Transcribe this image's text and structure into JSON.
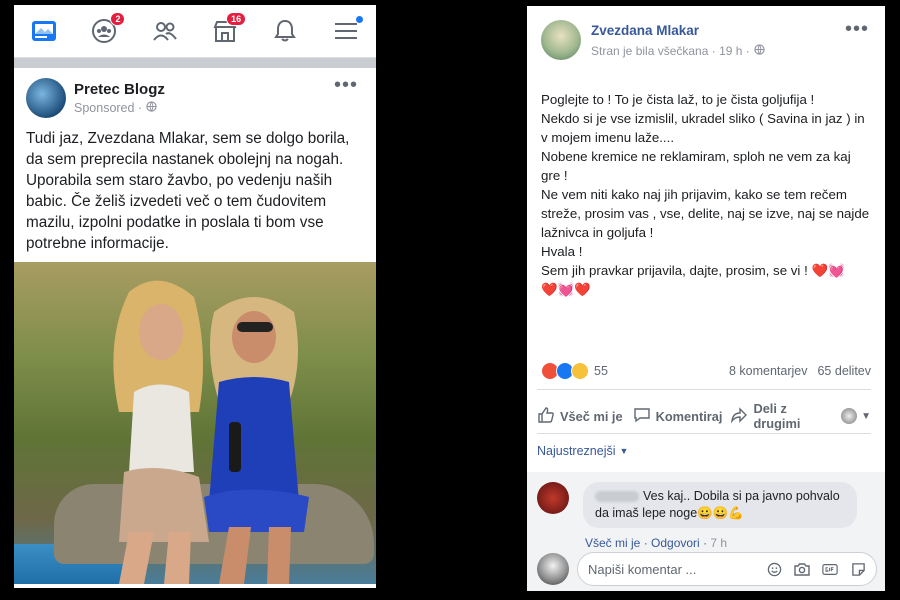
{
  "phone": {
    "nav": {
      "friend_requests_badge": "2",
      "marketplace_badge": "16"
    },
    "post": {
      "author": "Pretec Blogz",
      "meta": "Sponsored ·",
      "text": "Tudi jaz, Zvezdana Mlakar, sem se dolgo borila, da sem preprecila nastanek obolejnj na nogah. Uporabila sem staro žavbo, po vedenju naših babic. Če želiš izvedeti več o tem čudovitem mazilu, izpolni podatke in poslala ti bom vse potrebne informacije."
    }
  },
  "post": {
    "author": "Zvezdana Mlakar",
    "meta": "Stran je bila všečkana · 19 h ·",
    "lines": [
      "Poglejte to ! To je čista laž, to je čista goljufija !",
      "Nekdo si je vse izmislil, ukradel sliko ( Savina in jaz ) in v mojem imenu laže....",
      "Nobene kremice ne reklamiram, sploh ne vem za kaj gre !",
      "Ne vem niti kako naj jih prijavim, kako se tem rečem streže, prosim vas , vse, delite, naj se izve, naj se najde lažnivca in goljufa !",
      "Hvala !",
      "Sem jih pravkar prijavila, dajte, prosim, se vi !"
    ],
    "hearts_inline": "❤️💓",
    "hearts_line": "❤️💓❤️",
    "reactions_count": "55",
    "comments_count": "8 komentarjev",
    "shares_count": "65 delitev",
    "actions": {
      "like": "Všeč mi je",
      "comment": "Komentiraj",
      "share_line1": "Deli z",
      "share_line2": "drugimi"
    },
    "sort_label": "Najustreznejši"
  },
  "comment": {
    "text": "Ves kaj.. Dobila si pa javno pohvalo da imaš lepe noge😀😀💪",
    "like": "Všeč mi je",
    "reply": "Odgovori",
    "time": "7 h"
  },
  "composer": {
    "placeholder": "Napiši komentar ..."
  }
}
